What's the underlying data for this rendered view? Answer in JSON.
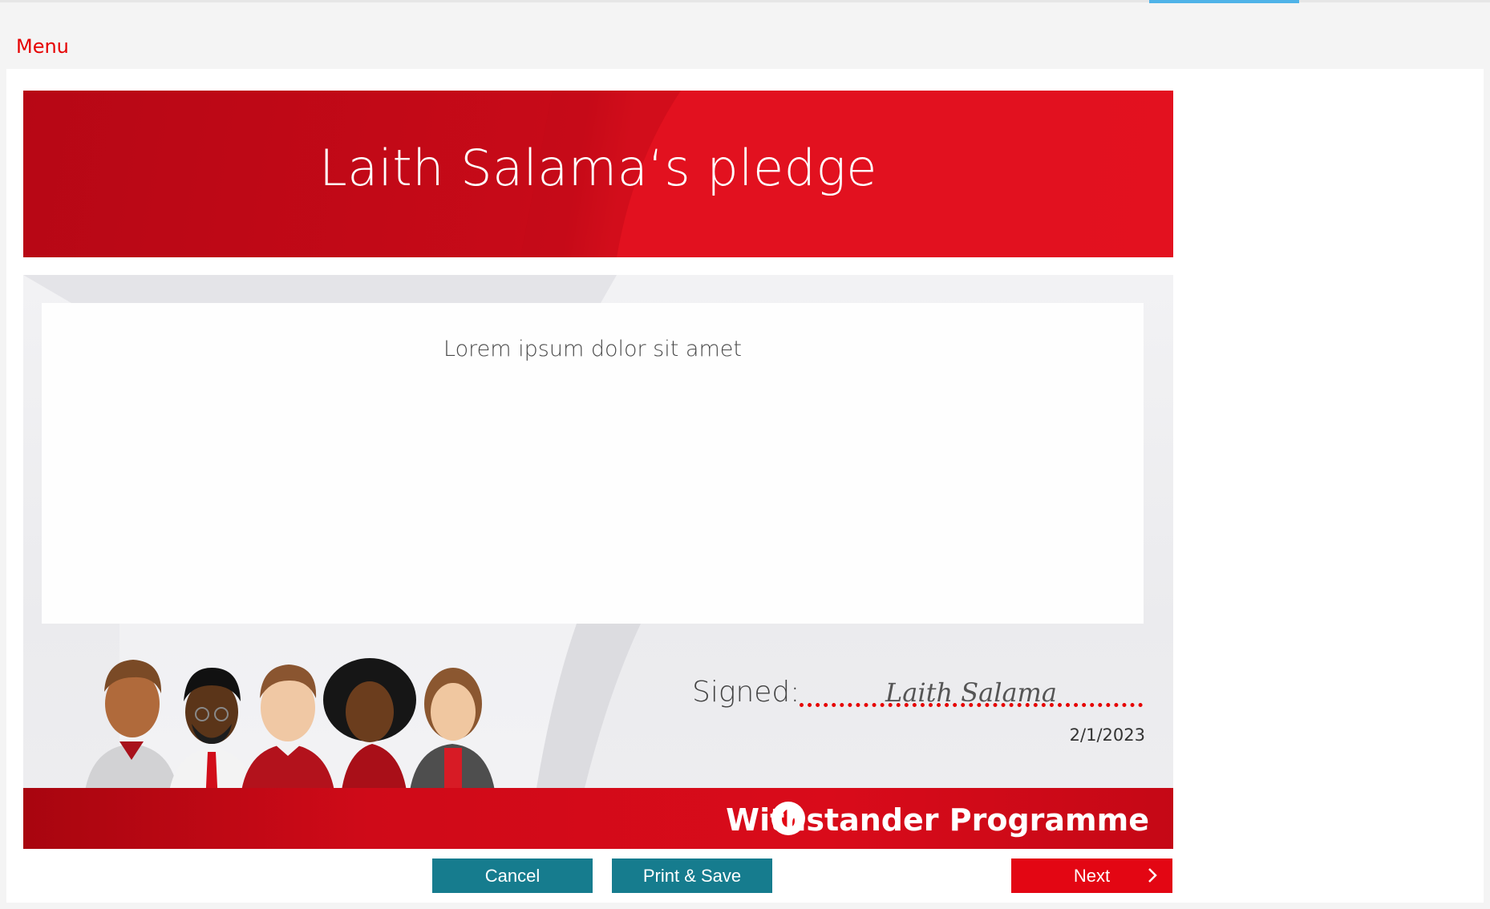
{
  "app": {
    "menu_label": "Menu"
  },
  "colors": {
    "brand_red": "#e60000",
    "button_teal": "#167c8e",
    "progress_blue": "#4fb3e8"
  },
  "header": {
    "title": "Laith Salama‘s pledge"
  },
  "pledge": {
    "text": "Lorem ipsum dolor sit amet"
  },
  "signature": {
    "label": "Signed:",
    "name": "Laith Salama",
    "date": "2/1/2023"
  },
  "footer": {
    "brand_name": "Withstander Programme",
    "logo_icon": "vodafone-speechmark-icon"
  },
  "buttons": {
    "cancel": "Cancel",
    "print_save": "Print & Save",
    "next": "Next"
  }
}
